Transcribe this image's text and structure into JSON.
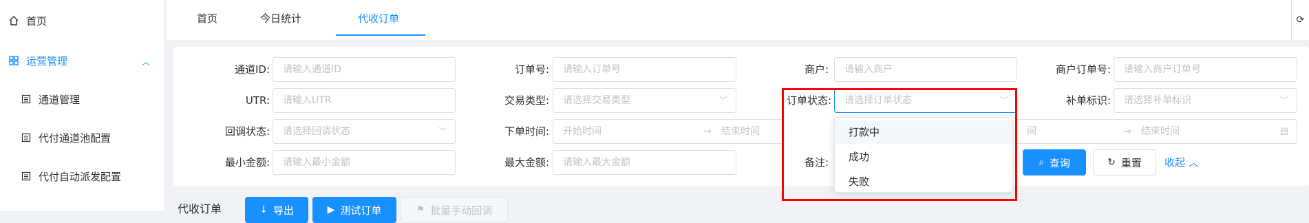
{
  "sidebar": {
    "home": "首页",
    "ops_group": "运营管理",
    "items": [
      "通道管理",
      "代付通道池配置",
      "代付自动派发配置"
    ]
  },
  "tabs": [
    "首页",
    "今日统计",
    "代收订单"
  ],
  "form": {
    "channel_id": {
      "label": "通道ID:",
      "placeholder": "请输入通道ID"
    },
    "order_no": {
      "label": "订单号:",
      "placeholder": "请输入订单号"
    },
    "merchant": {
      "label": "商户:",
      "placeholder": "请输入商户"
    },
    "merchant_order_no": {
      "label": "商户订单号:",
      "placeholder": "请输入商户订单号"
    },
    "utr": {
      "label": "UTR:",
      "placeholder": "请输入UTR"
    },
    "trade_type": {
      "label": "交易类型:",
      "placeholder": "请选择交易类型"
    },
    "order_status": {
      "label": "订单状态:",
      "placeholder": "请选择订单状态"
    },
    "supplement": {
      "label": "补单标识:",
      "placeholder": "请选择补单标识"
    },
    "callback_status": {
      "label": "回调状态:",
      "placeholder": "请选择回调状态"
    },
    "order_time": {
      "label": "下单时间:",
      "start": "开始时间",
      "end": "结束时间"
    },
    "second_time": {
      "start_fragment": "间",
      "end": "结束时间"
    },
    "min_amount": {
      "label": "最小金额:",
      "placeholder": "请输入最小金额"
    },
    "max_amount": {
      "label": "最大金额:",
      "placeholder": "请输入最大金额"
    },
    "remark": {
      "label": "备注:"
    }
  },
  "buttons": {
    "search": "查询",
    "reset": "重置",
    "collapse": "收起",
    "export": "导出",
    "test_order": "测试订单",
    "batch_callback": "批量手动回调"
  },
  "dropdown": {
    "options": [
      "打款中",
      "成功",
      "失败"
    ]
  },
  "bottom_title": "代收订单",
  "colors": {
    "accent": "#1890ff",
    "highlight": "#ff0000"
  }
}
